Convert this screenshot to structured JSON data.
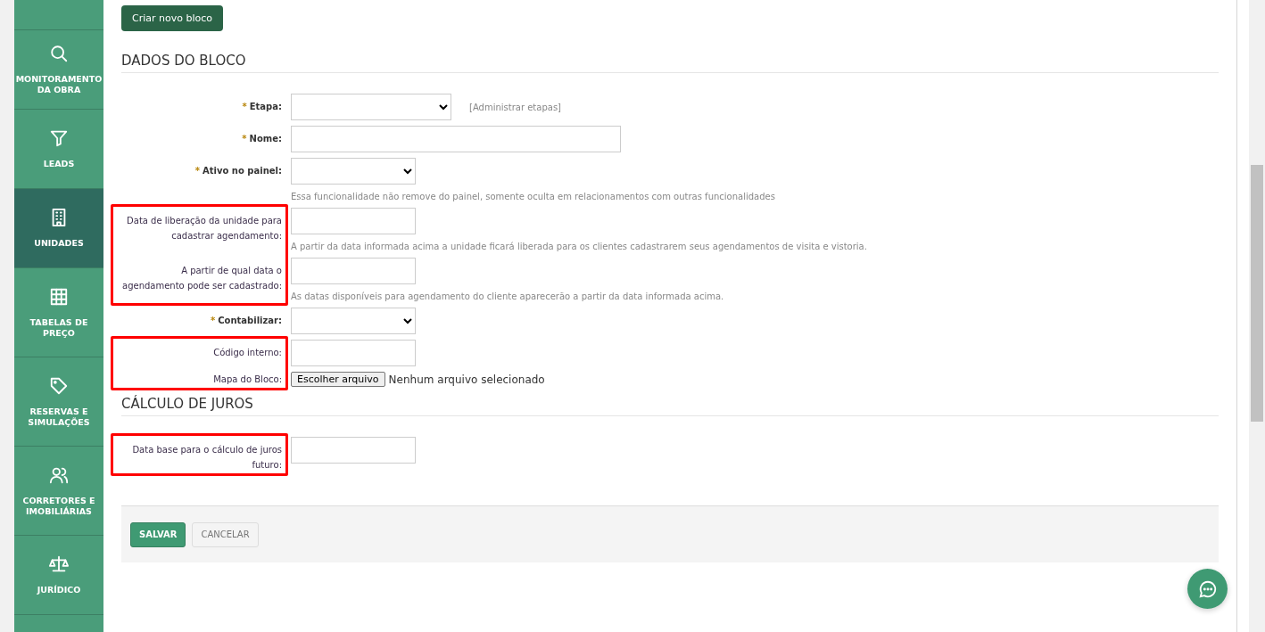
{
  "sidebar": {
    "items": [
      {
        "label": "MONITORAMENTO DA OBRA",
        "selected": false
      },
      {
        "label": "LEADS",
        "selected": false
      },
      {
        "label": "UNIDADES",
        "selected": true
      },
      {
        "label": "TABELAS DE PREÇO",
        "selected": false
      },
      {
        "label": "RESERVAS E SIMULAÇÕES",
        "selected": false
      },
      {
        "label": "CORRETORES E IMOBILIÁRIAS",
        "selected": false
      },
      {
        "label": "JURÍDICO",
        "selected": false
      }
    ]
  },
  "create_button": "Criar novo bloco",
  "sections": [
    {
      "title": "DADOS DO BLOCO",
      "fields": [
        {
          "kind": "select",
          "label": "Etapa:",
          "required": true,
          "required_mark": "*",
          "highlighted": false,
          "link": "[Administrar etapas]"
        },
        {
          "kind": "text",
          "label": "Nome:",
          "required": true,
          "required_mark": "*",
          "highlighted": false
        },
        {
          "kind": "select",
          "label": "Ativo no painel:",
          "required": true,
          "required_mark": "*",
          "highlighted": false,
          "help": "Essa funcionalidade não remove do painel, somente oculta em relacionamentos com outras funcionalidades"
        },
        {
          "kind": "text",
          "label": "Data de liberação da unidade para cadastrar agendamento:",
          "required": false,
          "highlighted": true,
          "help": "A partir da data informada acima a unidade ficará liberada para os clientes cadastrarem seus agendamentos de visita e vistoria."
        },
        {
          "kind": "text",
          "label": "A partir de qual data o agendamento pode ser cadastrado:",
          "required": false,
          "highlighted": true,
          "help": "As datas disponíveis para agendamento do cliente aparecerão a partir da data informada acima."
        },
        {
          "kind": "select",
          "label": "Contabilizar:",
          "required": true,
          "required_mark": "*",
          "highlighted": false
        },
        {
          "kind": "text",
          "label": "Código interno:",
          "required": false,
          "highlighted": true
        },
        {
          "kind": "file",
          "label": "Mapa do Bloco:",
          "required": false,
          "highlighted": true,
          "button": "Escolher arquivo",
          "status": "Nenhum arquivo selecionado"
        }
      ]
    },
    {
      "title": "CÁLCULO DE JUROS",
      "fields": [
        {
          "kind": "text",
          "label": "Data base para o cálculo de juros futuro:",
          "required": false,
          "highlighted": true
        }
      ]
    }
  ],
  "actions": [
    {
      "label": "SALVAR",
      "kind": "primary"
    },
    {
      "label": "CANCELAR",
      "kind": "secondary"
    }
  ]
}
